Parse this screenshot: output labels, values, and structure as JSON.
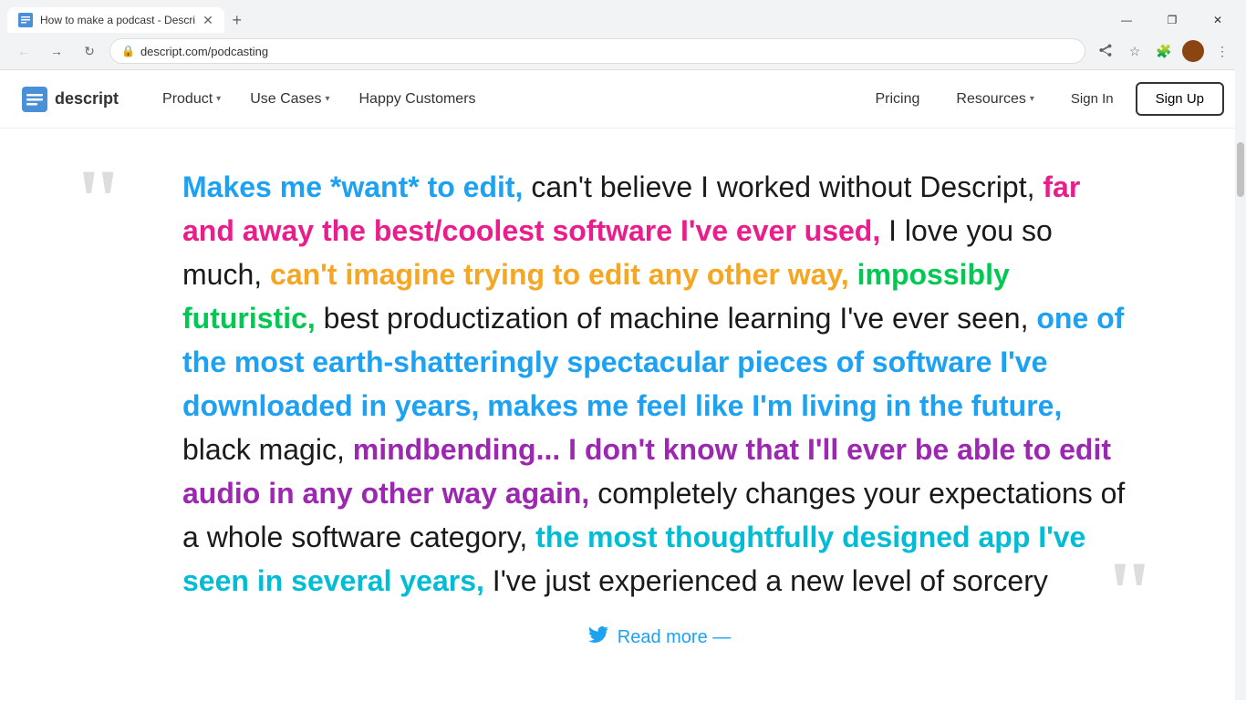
{
  "browser": {
    "tab_title": "How to make a podcast - Descri",
    "tab_favicon_text": "D",
    "url": "descript.com/podcasting",
    "window_controls": {
      "minimize": "—",
      "maximize": "❐",
      "close": "✕"
    }
  },
  "nav": {
    "logo_text": "descript",
    "items": [
      {
        "label": "Product",
        "has_chevron": true
      },
      {
        "label": "Use Cases",
        "has_chevron": true
      },
      {
        "label": "Happy Customers",
        "has_chevron": false
      }
    ],
    "right_items": [
      {
        "label": "Pricing",
        "has_chevron": false
      },
      {
        "label": "Resources",
        "has_chevron": true
      },
      {
        "label": "Sign In",
        "has_chevron": false
      }
    ],
    "signup_label": "Sign Up"
  },
  "testimonial": {
    "segments": [
      {
        "text": "Makes me *want* to edit,",
        "color": "blue"
      },
      {
        "text": " can't believe I worked without Descript, ",
        "color": "black"
      },
      {
        "text": "far and away the best/coolest software I've ever used,",
        "color": "pink"
      },
      {
        "text": "  I love you so much,  ",
        "color": "black"
      },
      {
        "text": "can't imagine trying to edit any other way,",
        "color": "orange"
      },
      {
        "text": " ",
        "color": "black"
      },
      {
        "text": "impossibly futuristic,",
        "color": "green"
      },
      {
        "text": "  best productization of machine learning I've ever seen,  ",
        "color": "black"
      },
      {
        "text": "one of the most earth-shatteringly spectacular pieces of software I've downloaded in years,",
        "color": "blue"
      },
      {
        "text": " ",
        "color": "black"
      },
      {
        "text": "makes me feel like I'm living in the future,",
        "color": "blue"
      },
      {
        "text": "  black magic,  ",
        "color": "black"
      },
      {
        "text": "mindbending... I don't know that I'll ever be able to edit audio in any other way again,",
        "color": "purple"
      },
      {
        "text": "  completely changes your expectations of a whole software category, ",
        "color": "black"
      },
      {
        "text": "the most thoughtfully designed app I've seen in several years,",
        "color": "teal"
      },
      {
        "text": " I've just experienced a new level of sorcery",
        "color": "black"
      }
    ],
    "read_more_label": "Read more —"
  }
}
